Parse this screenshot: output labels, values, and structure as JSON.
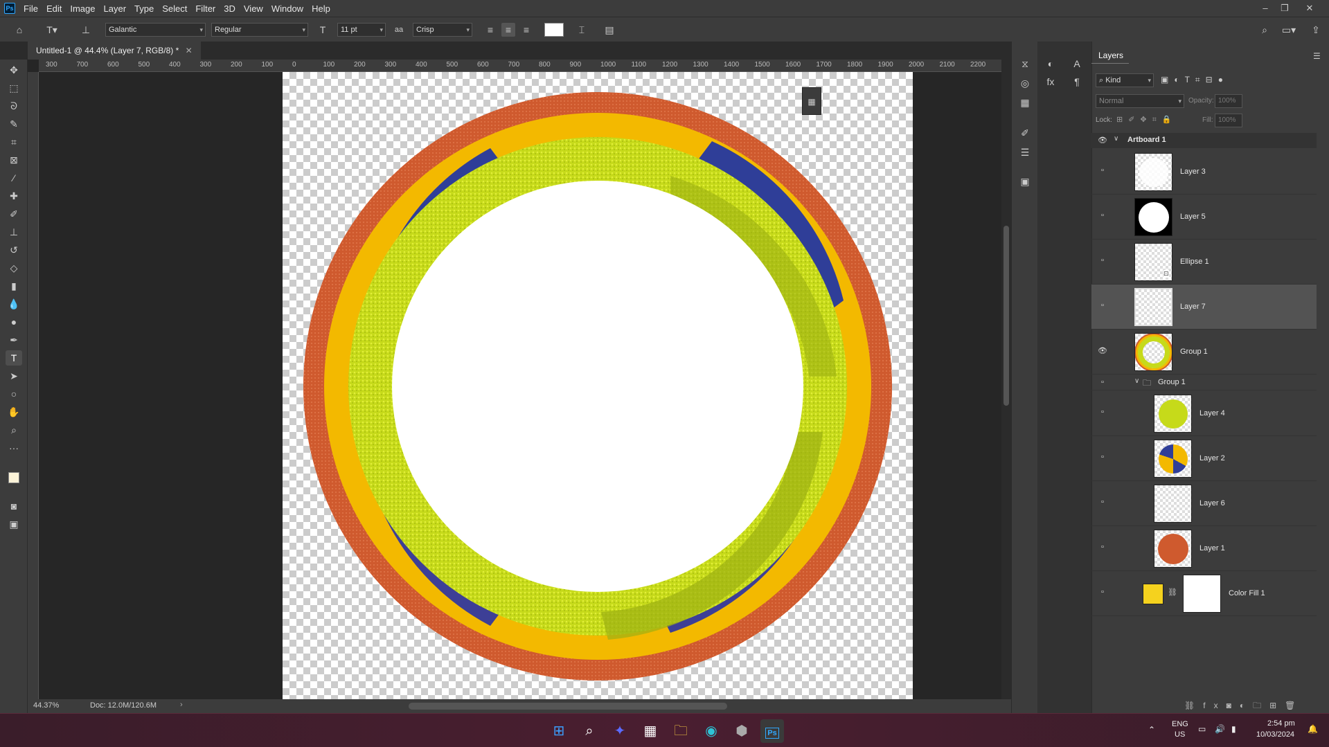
{
  "menubar": {
    "items": [
      "File",
      "Edit",
      "Image",
      "Layer",
      "Type",
      "Select",
      "Filter",
      "3D",
      "View",
      "Window",
      "Help"
    ],
    "logo": "Ps"
  },
  "options": {
    "font_family": "Galantic",
    "font_style": "Regular",
    "font_size": "11 pt",
    "antialias": "Crisp",
    "aa_symbol": "aa"
  },
  "document": {
    "tab_title": "Untitled-1 @ 44.4% (Layer 7, RGB/8) *"
  },
  "ruler": {
    "h": [
      "300",
      "700",
      "600",
      "500",
      "400",
      "300",
      "200",
      "100",
      "0",
      "100",
      "200",
      "300",
      "400",
      "500",
      "600",
      "700",
      "800",
      "900",
      "1000",
      "1100",
      "1200",
      "1300",
      "1400",
      "1500",
      "1600",
      "1700",
      "1800",
      "1900",
      "2000",
      "2100",
      "2200",
      "2"
    ]
  },
  "status": {
    "zoom": "44.37%",
    "doc": "Doc: 12.0M/120.6M"
  },
  "layers_panel": {
    "title": "Layers",
    "filter": "Kind",
    "blend_mode": "Normal",
    "opacity_label": "Opacity:",
    "opacity_value": "100%",
    "lock_label": "Lock:",
    "fill_label": "Fill:",
    "fill_value": "100%",
    "artboard": "Artboard 1",
    "layers": [
      {
        "name": "Layer 3"
      },
      {
        "name": "Layer 5"
      },
      {
        "name": "Ellipse 1"
      },
      {
        "name": "Layer 7"
      },
      {
        "name": "Group 1"
      },
      {
        "name": "Group 1"
      },
      {
        "name": "Layer 4"
      },
      {
        "name": "Layer 2"
      },
      {
        "name": "Layer 6"
      },
      {
        "name": "Layer 1"
      },
      {
        "name": "Color Fill 1"
      }
    ]
  },
  "taskbar": {
    "lang": "ENG",
    "region": "US",
    "time": "2:54 pm",
    "date": "10/03/2024"
  },
  "colors": {
    "accent": "#31a8ff",
    "fill_swatch": "#f5d21e"
  }
}
